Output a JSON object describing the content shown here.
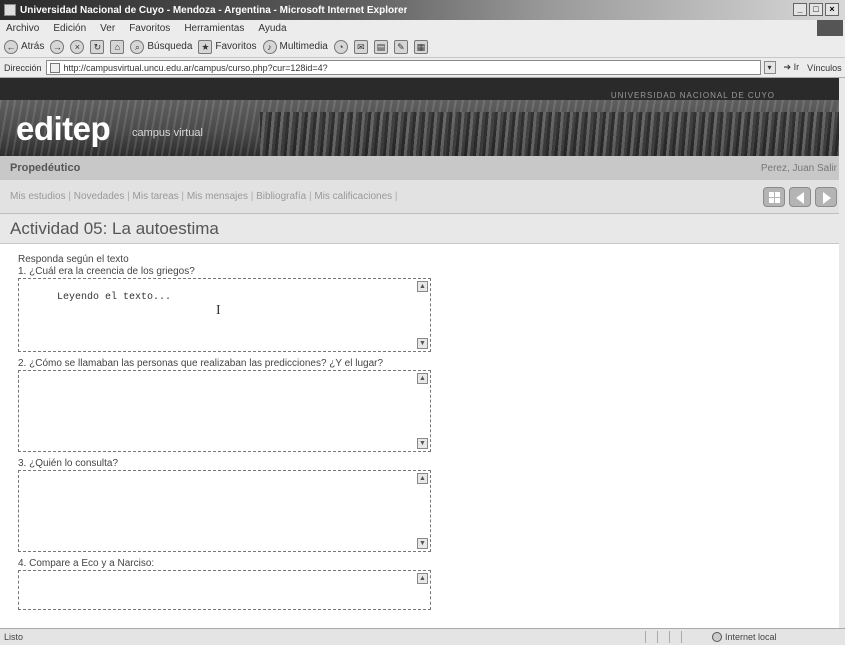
{
  "window": {
    "title": "Universidad Nacional de Cuyo - Mendoza - Argentina - Microsoft Internet Explorer",
    "minimize": "_",
    "maximize": "□",
    "close": "×"
  },
  "menu": [
    "Archivo",
    "Edición",
    "Ver",
    "Favoritos",
    "Herramientas",
    "Ayuda"
  ],
  "toolbar": {
    "back_label": "Atrás",
    "search_label": "Búsqueda",
    "favorites_label": "Favoritos",
    "multimedia_label": "Multimedia"
  },
  "address": {
    "label": "Dirección",
    "url": "http://campusvirtual.uncu.edu.ar/campus/curso.php?cur=128id=4?",
    "go_label": "Ir",
    "links_label": "Vínculos"
  },
  "site": {
    "university": "UNIVERSIDAD NACIONAL DE CUYO",
    "logo": "editep",
    "logo_sub": "campus virtual",
    "course": "Propedéutico",
    "user": "Perez, Juan  Salir"
  },
  "nav": {
    "links": [
      "Mis estudios",
      "Novedades",
      "Mis tareas",
      "Mis mensajes",
      "Bibliografía",
      "Mis calificaciones"
    ],
    "separator": "|"
  },
  "activity": {
    "title": "Actividad 05: La autoestima",
    "instructions": "Responda según el texto",
    "questions": [
      {
        "label": "1. ¿Cuál era la creencia de los griegos?",
        "answer": "Leyendo el texto..."
      },
      {
        "label": "2. ¿Cómo se llamaban las personas que realizaban las predicciones? ¿Y el lugar?",
        "answer": ""
      },
      {
        "label": "3. ¿Quién lo consulta?",
        "answer": ""
      },
      {
        "label": "4. Compare a Eco y a Narciso:",
        "answer": ""
      }
    ]
  },
  "status": {
    "left": "Listo",
    "zone": "Internet local"
  }
}
